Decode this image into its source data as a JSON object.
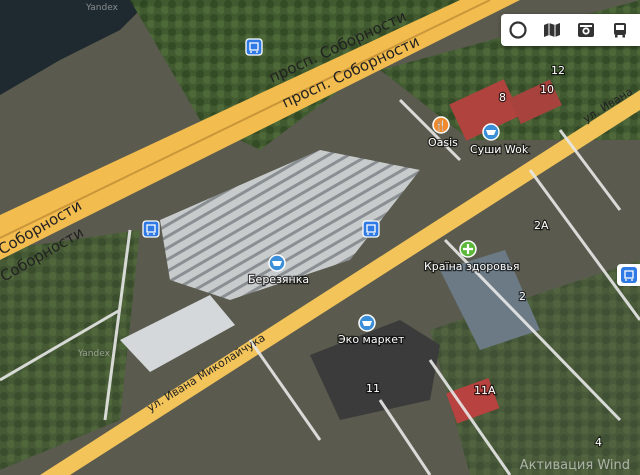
{
  "map": {
    "attribution_top": "Yandex",
    "attribution_bottom": "Yandex",
    "roads": {
      "main_top": "просп. Соборности",
      "main_top_2": "просп. Соборности",
      "main_left": "Соборности",
      "main_left_2": "Соборности",
      "street_bottom": "ул. Ивана Миколайчука",
      "street_right": "ул. Ивана"
    },
    "pois": [
      {
        "name": "Oasis",
        "icon": "food-icon",
        "color": "#f08a2e"
      },
      {
        "name": "Суши Wok",
        "icon": "shop-basket-icon",
        "color": "#3a8fd8"
      },
      {
        "name": "Країна здоровья",
        "icon": "pharmacy-icon",
        "color": "#5cb83a"
      },
      {
        "name": "Березянка",
        "icon": "shop-basket-icon",
        "color": "#3a8fd8"
      },
      {
        "name": "Эко маркет",
        "icon": "shop-basket-icon",
        "color": "#3a8fd8"
      }
    ],
    "house_numbers": {
      "n12": "12",
      "n10": "10",
      "n8": "8",
      "n2a": "2А",
      "n2": "2",
      "n11": "11",
      "n11a": "11А",
      "n4": "4"
    },
    "transit_icons": [
      "bus-stop-icon",
      "bus-stop-icon",
      "bus-stop-icon",
      "bus-stop-icon"
    ]
  },
  "layer_bar": {
    "items": [
      "traffic-layer-icon",
      "map-layer-icon",
      "panorama-icon",
      "transit-layer-icon"
    ]
  },
  "watermark": "Активация Wind"
}
